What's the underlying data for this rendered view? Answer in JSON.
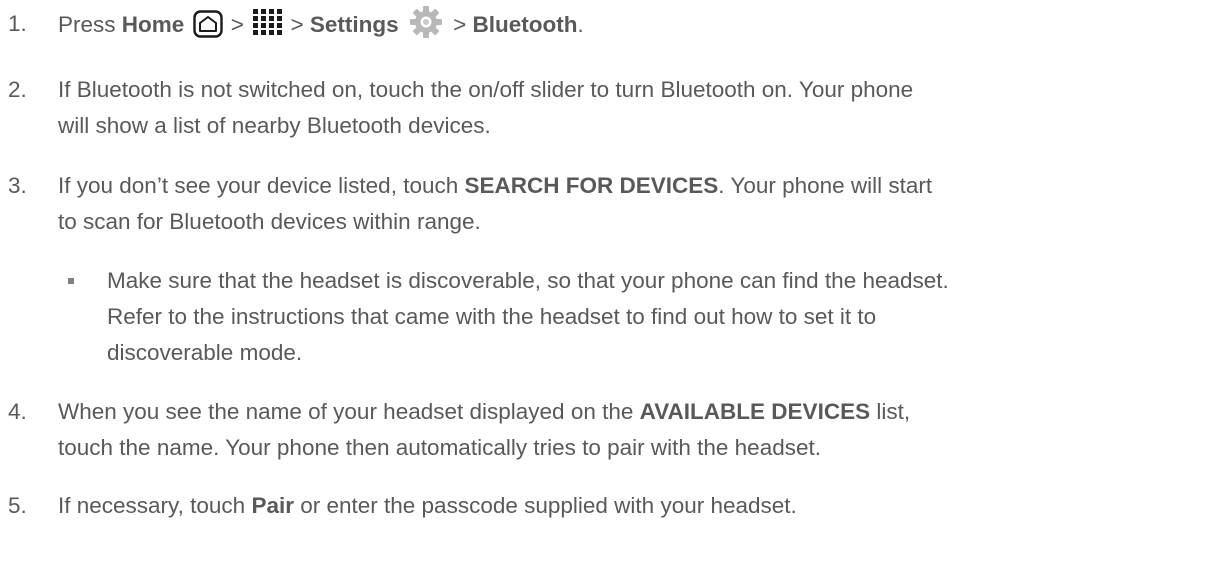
{
  "steps": [
    {
      "num": "1.",
      "press": "Press ",
      "home": "Home",
      "sep1": " > ",
      "sep2": " > ",
      "settings": "Settings",
      "sep3": " > ",
      "bluetooth": "Bluetooth",
      "end": ".",
      "icons": [
        "home-button-icon",
        "apps-grid-icon",
        "settings-gear-icon"
      ]
    },
    {
      "num": "2.",
      "line1": "If Bluetooth is not switched on, touch the on/off slider to turn Bluetooth on. Your phone",
      "line2": "will show a list of nearby Bluetooth devices."
    },
    {
      "num": "3.",
      "pre": "If you don’t see your device listed, touch ",
      "bold": "SEARCH FOR DEVICES",
      "post": ". Your phone will start",
      "line2": "to scan for Bluetooth devices within range."
    },
    {
      "num": "4.",
      "pre": "When you see the name of your headset displayed on the ",
      "bold": "AVAILABLE DEVICES",
      "post": " list,",
      "line2": "touch the name. Your phone then automatically tries to pair with the headset."
    },
    {
      "num": "5.",
      "pre": "If necessary, touch ",
      "bold": "Pair",
      "post": " or enter the passcode supplied with your headset."
    }
  ],
  "bullet": {
    "line1": "Make sure that the headset is discoverable, so that your phone can find the headset.",
    "line2": "Refer to the instructions that came with the headset to find out how to set it to",
    "line3": "discoverable mode."
  },
  "colors": {
    "text": "#595959",
    "gear": "#b8b8b8",
    "icon": "#1a1a1a"
  }
}
